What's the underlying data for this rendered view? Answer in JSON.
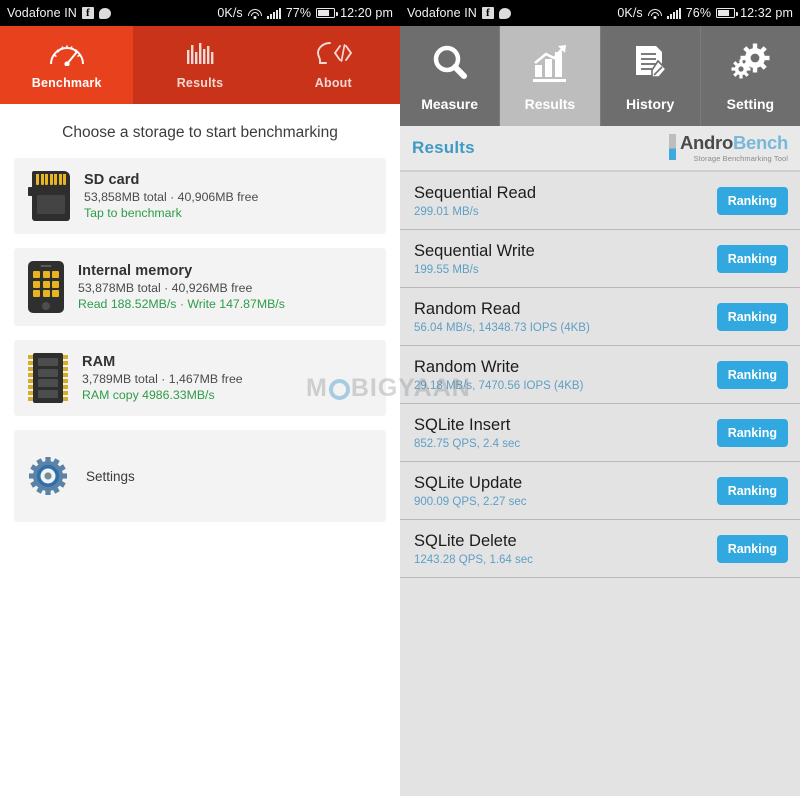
{
  "left": {
    "statusbar": {
      "carrier": "Vodafone IN",
      "facebook_icon": "facebook-icon",
      "messenger_icon": "messenger-icon",
      "data_speed": "0K/s",
      "wifi_icon": "wifi-icon",
      "signal_icon": "signal-bars-icon",
      "battery_percent": "77%",
      "battery_icon": "battery-icon",
      "time": "12:20 pm"
    },
    "tabs": [
      {
        "label": "Benchmark",
        "icon": "speedometer-icon",
        "active": true
      },
      {
        "label": "Results",
        "icon": "bar-chart-icon",
        "active": false
      },
      {
        "label": "About",
        "icon": "head-code-icon",
        "active": false
      }
    ],
    "heading": "Choose a storage to start benchmarking",
    "cards": [
      {
        "icon": "sd-card-icon",
        "title": "SD card",
        "capacity": "53,858MB total · 40,906MB free",
        "stat": "Tap to benchmark"
      },
      {
        "icon": "phone-memory-icon",
        "title": "Internal memory",
        "capacity": "53,878MB total · 40,926MB free",
        "stat": "Read 188.52MB/s · Write 147.87MB/s"
      },
      {
        "icon": "ram-chip-icon",
        "title": "RAM",
        "capacity": "3,789MB total · 1,467MB free",
        "stat": "RAM copy 4986.33MB/s"
      }
    ],
    "settings": {
      "label": "Settings",
      "icon": "gear-icon"
    }
  },
  "right": {
    "statusbar": {
      "carrier": "Vodafone IN",
      "facebook_icon": "facebook-icon",
      "messenger_icon": "messenger-icon",
      "data_speed": "0K/s",
      "wifi_icon": "wifi-icon",
      "signal_icon": "signal-bars-icon",
      "battery_percent": "76%",
      "battery_icon": "battery-icon",
      "time": "12:32 pm"
    },
    "tabs": [
      {
        "label": "Measure",
        "icon": "magnifier-icon",
        "active": false
      },
      {
        "label": "Results",
        "icon": "chart-growth-icon",
        "active": true
      },
      {
        "label": "History",
        "icon": "document-pencil-icon",
        "active": false
      },
      {
        "label": "Setting",
        "icon": "gears-icon",
        "active": false
      }
    ],
    "header": {
      "title": "Results",
      "logo_main_a": "Andro",
      "logo_main_b": "Bench",
      "logo_sub": "Storage Benchmarking Tool"
    },
    "results": [
      {
        "name": "Sequential Read",
        "value": "299.01 MB/s",
        "button": "Ranking"
      },
      {
        "name": "Sequential Write",
        "value": "199.55 MB/s",
        "button": "Ranking"
      },
      {
        "name": "Random Read",
        "value": "56.04 MB/s, 14348.73 IOPS (4KB)",
        "button": "Ranking"
      },
      {
        "name": "Random Write",
        "value": "29.18 MB/s, 7470.56 IOPS (4KB)",
        "button": "Ranking"
      },
      {
        "name": "SQLite Insert",
        "value": "852.75 QPS, 2.4 sec",
        "button": "Ranking"
      },
      {
        "name": "SQLite Update",
        "value": "900.09 QPS, 2.27 sec",
        "button": "Ranking"
      },
      {
        "name": "SQLite Delete",
        "value": "1243.28 QPS, 1.64 sec",
        "button": "Ranking"
      }
    ]
  },
  "watermark": {
    "before": "M",
    "ring": "O",
    "after": "BIGYAAN"
  },
  "colors": {
    "left_tab_active": "#e8411e",
    "left_tab_bar": "#c9331a",
    "stat_green": "#2e9c49",
    "right_tab_bar": "#6e6e6e",
    "right_tab_active": "#bdbdbd",
    "accent_blue": "#31a9e0",
    "title_blue": "#3f9bc4"
  }
}
